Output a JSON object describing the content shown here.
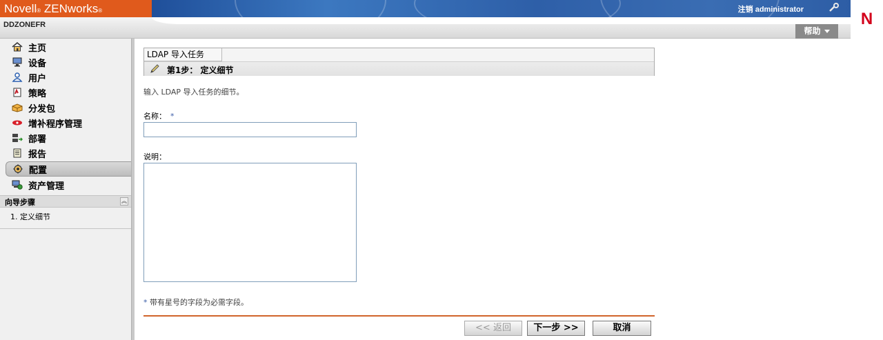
{
  "header": {
    "brand": "Novell",
    "brand_reg": "®",
    "product": "ZENworks",
    "product_reg": "®",
    "logout_label": "注销 administrator",
    "zone_name": "DDZONEFR",
    "help_label": "帮助",
    "logo_letter": "N"
  },
  "sidebar": {
    "items": [
      {
        "label": "主页",
        "icon": "home-icon"
      },
      {
        "label": "设备",
        "icon": "monitor-icon"
      },
      {
        "label": "用户",
        "icon": "user-icon"
      },
      {
        "label": "策略",
        "icon": "policy-icon"
      },
      {
        "label": "分发包",
        "icon": "bundle-icon"
      },
      {
        "label": "增补程序管理",
        "icon": "patch-icon"
      },
      {
        "label": "部署",
        "icon": "deploy-icon"
      },
      {
        "label": "报告",
        "icon": "report-icon"
      },
      {
        "label": "配置",
        "icon": "config-icon",
        "active": true
      },
      {
        "label": "资产管理",
        "icon": "asset-icon"
      }
    ],
    "wizard_title": "向导步骤",
    "wizard_steps": [
      "1. 定义细节"
    ]
  },
  "main": {
    "task_title": "LDAP 导入任务",
    "step_label": "第1步： 定义细节",
    "intro": "输入 LDAP 导入任务的细节。",
    "name_label": "名称：",
    "required_marker": "*",
    "name_value": "",
    "description_label": "说明：",
    "description_value": "",
    "required_note": "带有星号的字段为必需字段。",
    "buttons": {
      "back": "<< 返回",
      "next": "下一步 >>",
      "cancel": "取消"
    }
  },
  "colors": {
    "brand_orange": "#e05a1c",
    "banner_blue": "#2e5fa8",
    "logo_red": "#d3001b",
    "rule_orange": "#d0642a"
  }
}
